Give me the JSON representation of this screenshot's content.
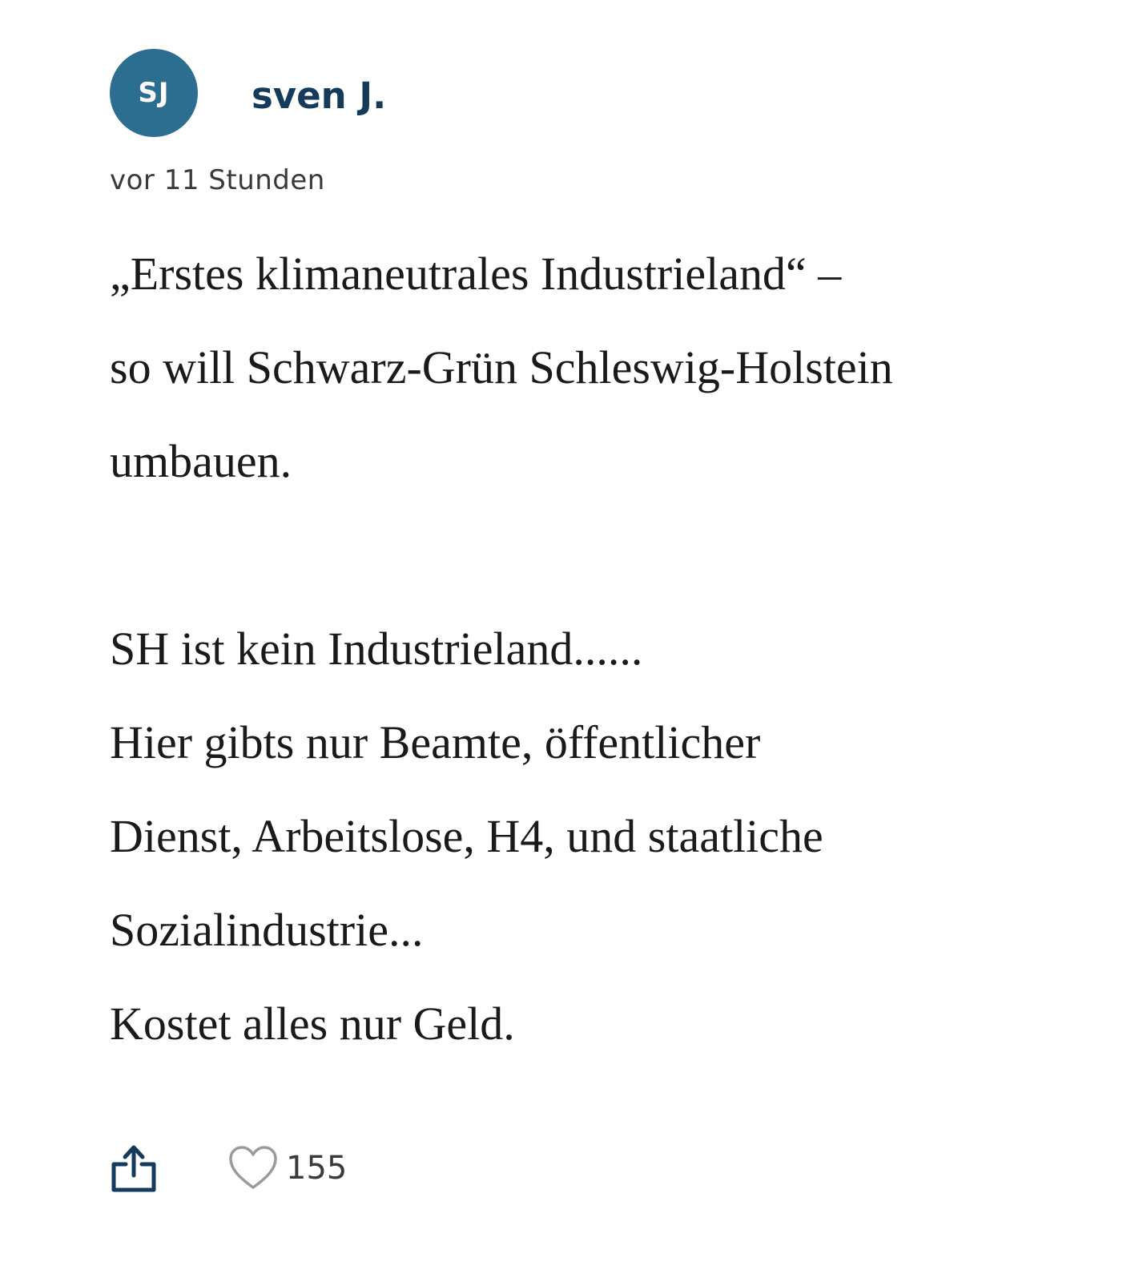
{
  "colors": {
    "avatar_bg": "#2c6e8f",
    "author_name": "#143a5c",
    "icon": "#143a5c",
    "heart": "#9a9a9a"
  },
  "comment": {
    "avatar_initials": "SJ",
    "author": "sven J.",
    "timestamp": "vor 11 Stunden",
    "paragraphs": [
      {
        "lines": [
          "„Erstes klimaneutrales Industrieland“ –",
          "so will Schwarz-Grün Schleswig-Holstein",
          "umbauen."
        ]
      },
      {
        "lines": [
          "SH ist kein Industrieland......",
          "Hier gibts nur Beamte, öffentlicher",
          "Dienst, Arbeitslose, H4, und staatliche",
          "Sozialindustrie...",
          "Kostet alles nur Geld."
        ]
      }
    ],
    "actions": {
      "share_icon": "share-icon",
      "like_icon": "heart-icon",
      "like_count": "155"
    }
  }
}
